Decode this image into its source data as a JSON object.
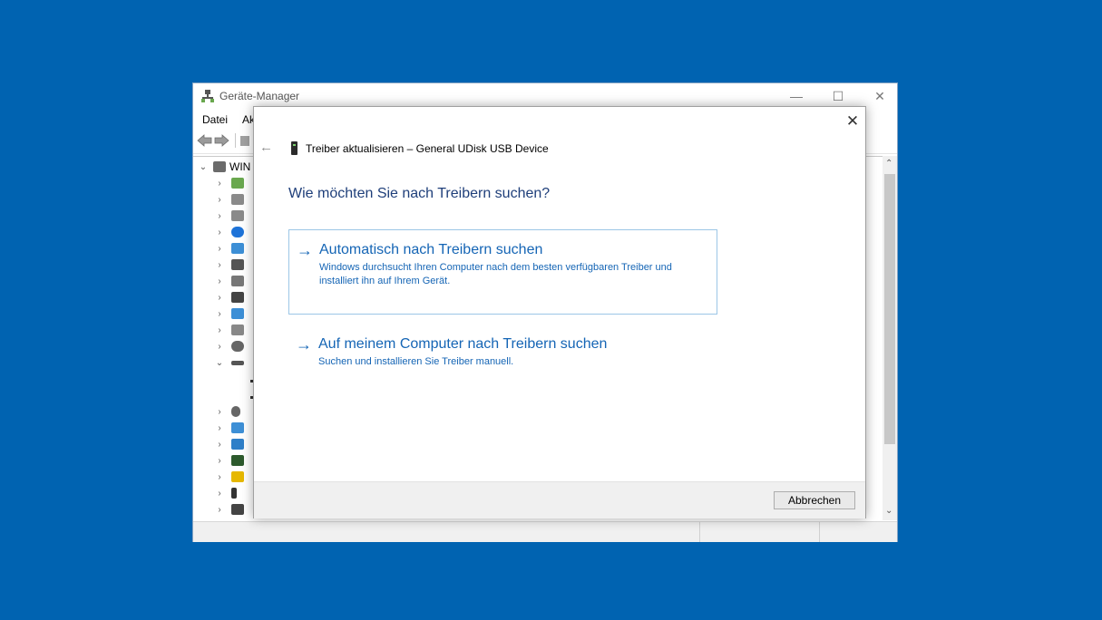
{
  "device_manager": {
    "title": "Geräte-Manager",
    "menu": {
      "file": "Datei",
      "action": "Aktion"
    },
    "tree_root": "WIN",
    "window_controls": {
      "minimize": "—",
      "maximize": "☐",
      "close": "✕"
    }
  },
  "dialog": {
    "title": "Treiber aktualisieren – General UDisk USB Device",
    "heading": "Wie möchten Sie nach Treibern suchen?",
    "options": [
      {
        "title": "Automatisch nach Treibern suchen",
        "description": "Windows durchsucht Ihren Computer nach dem besten verfügbaren Treiber und installiert ihn auf Ihrem Gerät."
      },
      {
        "title": "Auf meinem Computer nach Treibern suchen",
        "description": "Suchen und installieren Sie Treiber manuell."
      }
    ],
    "cancel_label": "Abbrechen",
    "close_glyph": "✕",
    "back_glyph": "←",
    "arrow_glyph": "→"
  },
  "colors": {
    "desktop": "#0063b1",
    "accent": "#1565b5",
    "heading": "#1f3f7a"
  }
}
